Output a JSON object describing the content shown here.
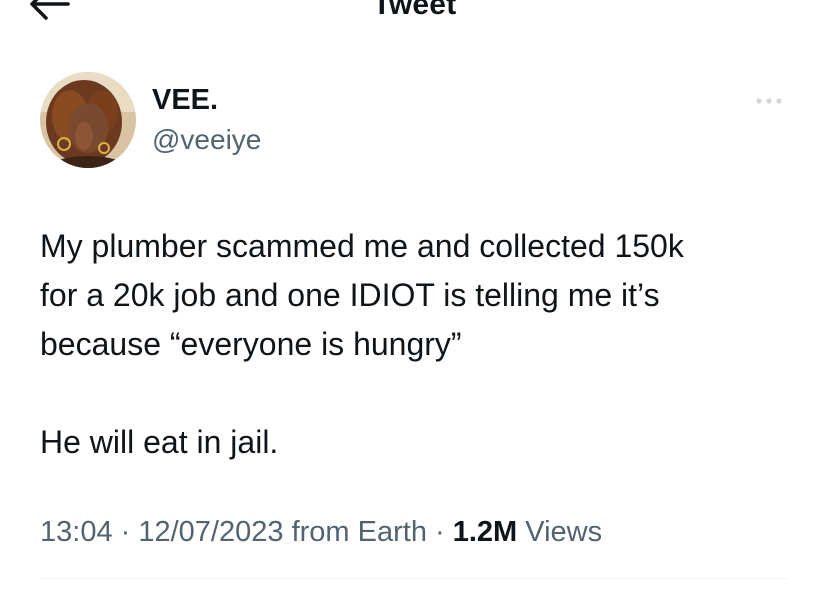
{
  "header": {
    "title": "Tweet",
    "back_icon": "arrow-left-icon"
  },
  "author": {
    "display_name": "VEE.",
    "handle": "@veeiye",
    "avatar_icon": "avatar-photo",
    "more_icon": "more-horizontal-icon"
  },
  "tweet": {
    "paragraphs": [
      "My plumber scammed me and collected 150k\nfor a 20k job and one IDIOT is telling me it’s\nbecause “everyone is hungry”",
      "He will eat in jail."
    ]
  },
  "meta": {
    "time": "13:04",
    "separator": " · ",
    "date": "12/07/2023",
    "source": " from Earth",
    "views_count": "1.2M",
    "views_label": " Views"
  },
  "colors": {
    "text_primary": "#0f1419",
    "text_secondary": "#536471",
    "divider": "#eff3f4",
    "background": "#ffffff"
  }
}
